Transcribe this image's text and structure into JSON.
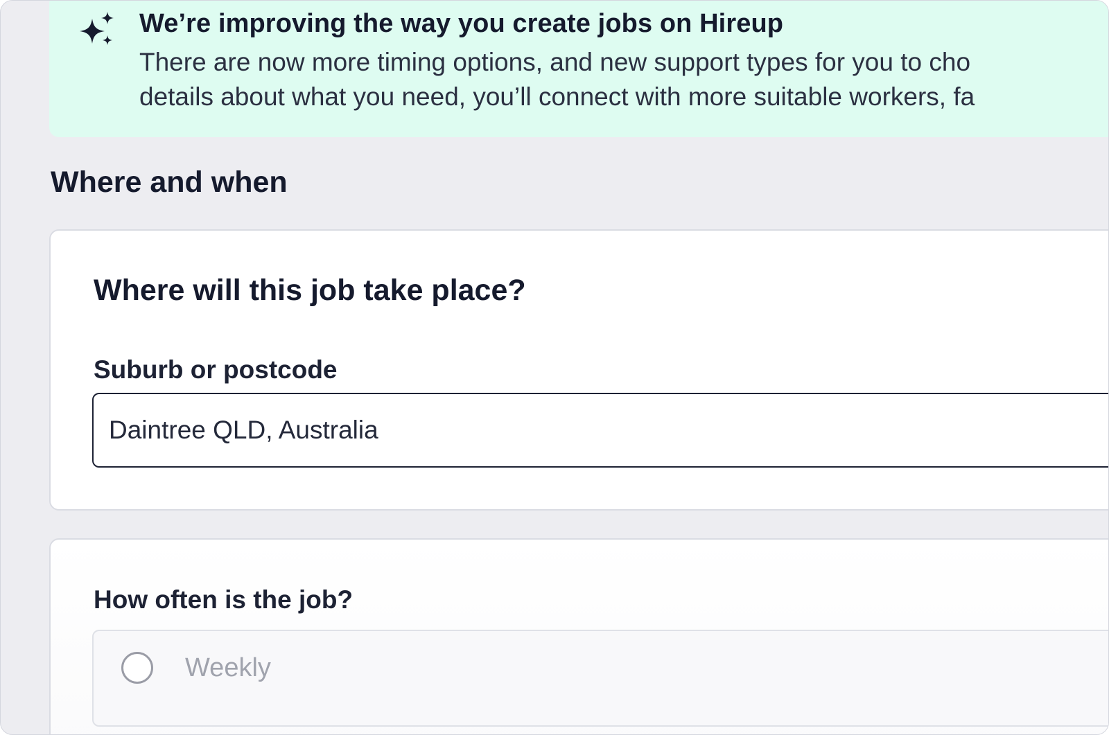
{
  "banner": {
    "icon": "sparkles-icon",
    "title": "We’re improving the way you create jobs on Hireup",
    "body_line_1": "There are now more timing options, and new support types for you to cho",
    "body_line_2": "details about what you need, you’ll connect with more suitable workers, fa",
    "background_color": "#defcf1"
  },
  "section": {
    "heading": "Where and when"
  },
  "location": {
    "question": "Where will this job take place?",
    "field_label": "Suburb or postcode",
    "field_value": "Daintree QLD, Australia"
  },
  "frequency": {
    "question": "How often is the job?",
    "options": [
      {
        "label": "Weekly",
        "selected": false
      }
    ]
  }
}
